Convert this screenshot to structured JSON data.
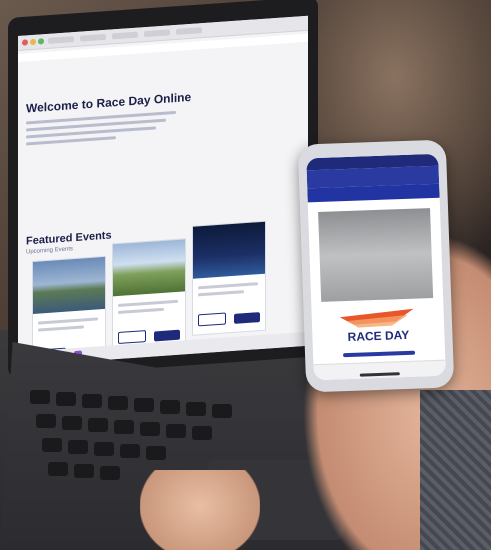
{
  "scene": {
    "laptop_page": {
      "title": "Welcome to Race Day Online",
      "section_title": "Featured Events",
      "section_subtitle": "Upcoming Events"
    },
    "phone_page": {
      "logo_text": "RACE DAY"
    },
    "colors": {
      "brand_blue": "#1f2a7a",
      "phone_header": "#2b3aa0",
      "logo_orange": "#e8562a"
    }
  }
}
